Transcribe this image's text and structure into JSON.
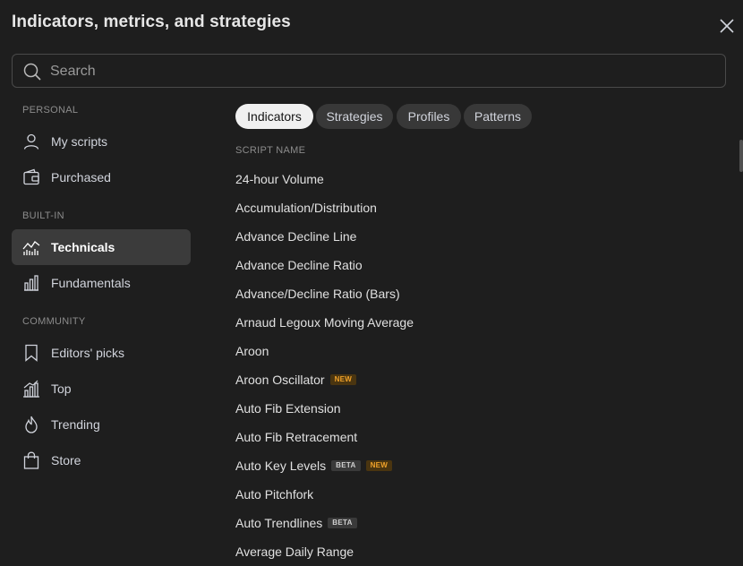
{
  "dialog": {
    "title": "Indicators, metrics, and strategies"
  },
  "search": {
    "placeholder": "Search",
    "value": ""
  },
  "sidebar": {
    "sections": {
      "personal": "PERSONAL",
      "builtin": "BUILT-IN",
      "community": "COMMUNITY"
    },
    "items": [
      {
        "label": "My scripts",
        "icon": "user-icon"
      },
      {
        "label": "Purchased",
        "icon": "wallet-icon"
      },
      {
        "label": "Technicals",
        "icon": "technicals-chart-icon",
        "active": true
      },
      {
        "label": "Fundamentals",
        "icon": "bar-chart-icon"
      },
      {
        "label": "Editors' picks",
        "icon": "bookmark-icon"
      },
      {
        "label": "Top",
        "icon": "top-chart-icon"
      },
      {
        "label": "Trending",
        "icon": "flame-icon"
      },
      {
        "label": "Store",
        "icon": "shopping-bag-icon"
      }
    ]
  },
  "tabs": [
    {
      "label": "Indicators",
      "active": true
    },
    {
      "label": "Strategies"
    },
    {
      "label": "Profiles"
    },
    {
      "label": "Patterns"
    }
  ],
  "list": {
    "header": "SCRIPT NAME",
    "items": [
      {
        "name": "24-hour Volume",
        "badges": []
      },
      {
        "name": "Accumulation/Distribution",
        "badges": []
      },
      {
        "name": "Advance Decline Line",
        "badges": []
      },
      {
        "name": "Advance Decline Ratio",
        "badges": []
      },
      {
        "name": "Advance/Decline Ratio (Bars)",
        "badges": []
      },
      {
        "name": "Arnaud Legoux Moving Average",
        "badges": []
      },
      {
        "name": "Aroon",
        "badges": []
      },
      {
        "name": "Aroon Oscillator",
        "badges": [
          "NEW"
        ]
      },
      {
        "name": "Auto Fib Extension",
        "badges": []
      },
      {
        "name": "Auto Fib Retracement",
        "badges": []
      },
      {
        "name": "Auto Key Levels",
        "badges": [
          "BETA",
          "NEW"
        ]
      },
      {
        "name": "Auto Pitchfork",
        "badges": []
      },
      {
        "name": "Auto Trendlines",
        "badges": [
          "BETA"
        ]
      },
      {
        "name": "Average Daily Range",
        "badges": []
      }
    ]
  },
  "colors": {
    "background": "#1e1e1e",
    "active_nav": "#3b3b3b",
    "new_badge": "#f0a22a",
    "tab_active": "#f0f0f0"
  }
}
